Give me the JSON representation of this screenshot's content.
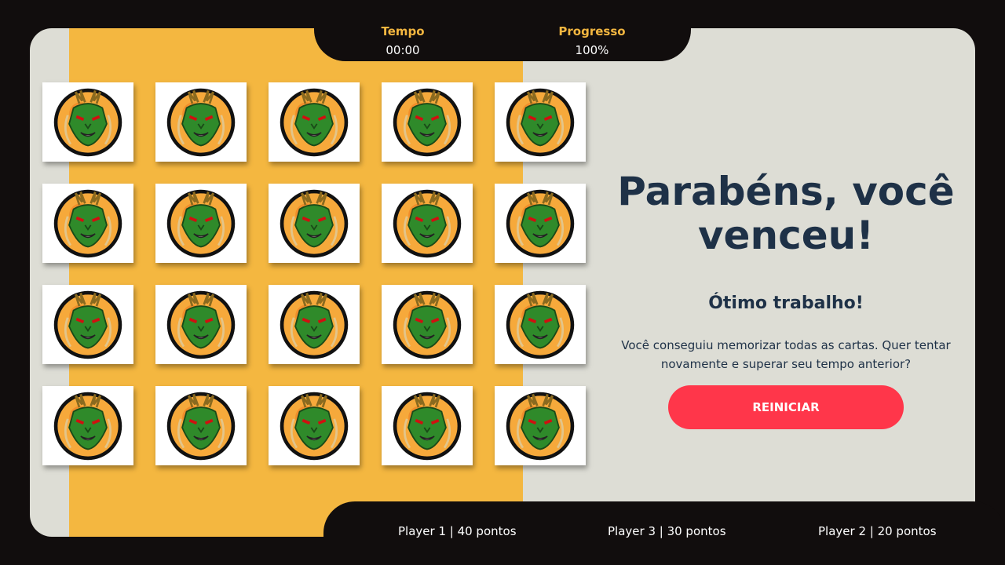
{
  "stats": {
    "time_label": "Tempo",
    "time_value": "00:00",
    "progress_label": "Progresso",
    "progress_value": "100%"
  },
  "cards": {
    "count": 20,
    "icon": "dragon-card-icon",
    "state": "revealed"
  },
  "win": {
    "title": "Parabéns, você venceu!",
    "subtitle": "Ótimo trabalho!",
    "message": "Você conseguiu memorizar todas as cartas. Quer tentar novamente e superar seu tempo anterior?",
    "restart_label": "REINICIAR"
  },
  "scores": [
    {
      "text": "Player 1 | 40 pontos"
    },
    {
      "text": "Player 3 | 30 pontos"
    },
    {
      "text": "Player 2 | 20 pontos"
    }
  ],
  "colors": {
    "background": "#110d0d",
    "board": "#ddddd5",
    "accent_yellow": "#f4b740",
    "heading": "#1e3147",
    "button": "#ff364a"
  }
}
